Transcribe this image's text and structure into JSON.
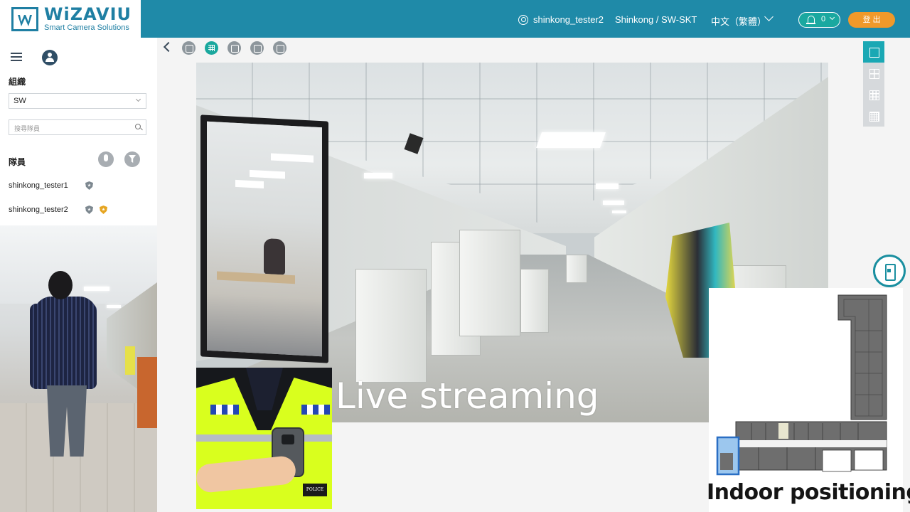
{
  "header": {
    "brand_name": "WiZAVIU",
    "brand_tagline": "Smart Camera Solutions",
    "username": "shinkong_tester2",
    "org_path": "Shinkong / SW-SKT",
    "language": "中文（繁體）",
    "notification_count": "0",
    "logout_label": "登 出",
    "colors": {
      "header_bg": "#1f8aa8",
      "logout_bg": "#f0992a",
      "notif_bg": "#1aa8a0"
    }
  },
  "sidebar": {
    "org_title": "組織",
    "org_selected": "SW",
    "search_placeholder": "搜尋隊員",
    "members_title": "隊員",
    "members": [
      {
        "name": "shinkong_tester1"
      },
      {
        "name": "shinkong_tester2"
      }
    ]
  },
  "toolbar": {
    "icons": [
      "download-icon",
      "grid-map-icon",
      "contacts-icon",
      "location-pin-icon",
      "history-icon"
    ]
  },
  "layout_options": [
    "single-view-icon",
    "grid-2x2-icon",
    "grid-3x3-icon",
    "grid-4x4-icon"
  ],
  "overlay": {
    "live_label": "Live streaming",
    "indoor_label": "Indoor positioning",
    "badge_text": "POLICE"
  }
}
